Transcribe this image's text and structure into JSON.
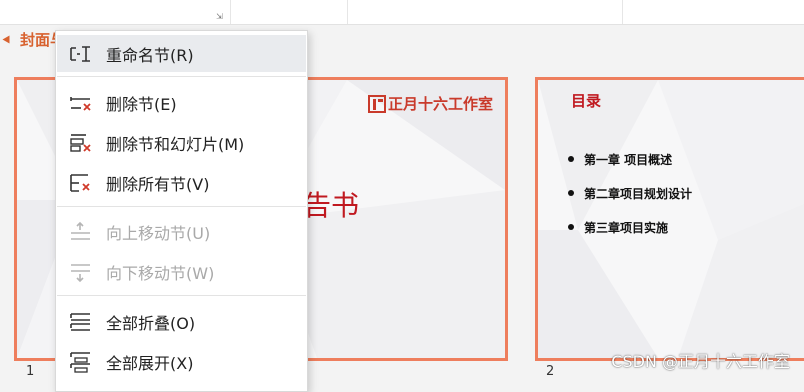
{
  "section": {
    "title": "封面与目录"
  },
  "slide1": {
    "logo_text": "正月十六工作室",
    "title_fragment": "告书",
    "number": "1"
  },
  "slide2": {
    "toc_title": "目录",
    "items": [
      "第一章 项目概述",
      "第二章项目规划设计",
      "第三章项目实施"
    ],
    "number": "2"
  },
  "menu": {
    "items": [
      {
        "label": "重命名节(R)",
        "icon": "rename-section-icon",
        "enabled": true
      },
      {
        "label": "删除节(E)",
        "icon": "delete-section-icon",
        "enabled": true
      },
      {
        "label": "删除节和幻灯片(M)",
        "icon": "delete-section-and-slides-icon",
        "enabled": true
      },
      {
        "label": "删除所有节(V)",
        "icon": "delete-all-sections-icon",
        "enabled": true
      },
      {
        "label": "向上移动节(U)",
        "icon": "move-section-up-icon",
        "enabled": false
      },
      {
        "label": "向下移动节(W)",
        "icon": "move-section-down-icon",
        "enabled": false
      },
      {
        "label": "全部折叠(O)",
        "icon": "collapse-all-icon",
        "enabled": true
      },
      {
        "label": "全部展开(X)",
        "icon": "expand-all-icon",
        "enabled": true
      }
    ]
  },
  "watermark": "CSDN @正月十六工作室",
  "colors": {
    "accent_orange": "#d8622f",
    "slide_border": "#ee7e5d",
    "title_red": "#c01920",
    "menu_hover": "#e9ebee"
  }
}
